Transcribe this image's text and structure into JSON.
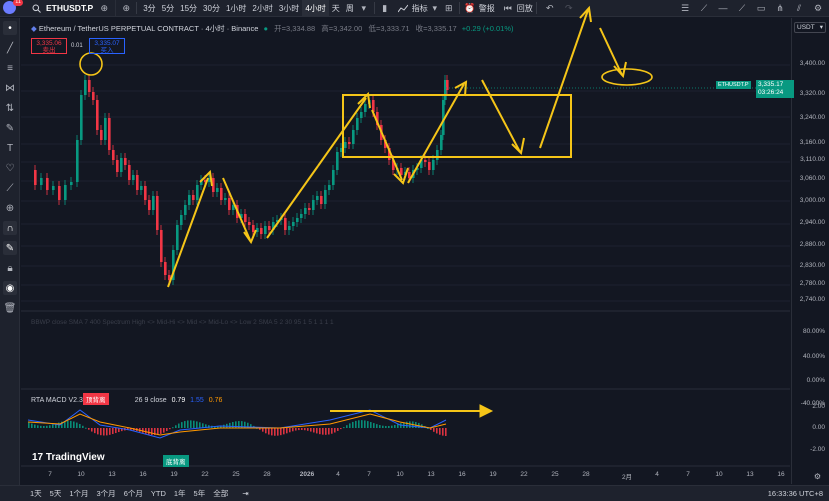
{
  "toolbar": {
    "badge": "11",
    "symbol": "ETHUSDT.P",
    "intervals": [
      "3分",
      "5分",
      "15分",
      "30分",
      "1小时",
      "2小时",
      "3小时",
      "4小时",
      "天",
      "周"
    ],
    "active_interval": "4小时",
    "indicators_label": "指标",
    "alert_label": "警报",
    "replay_label": "回放"
  },
  "legend": {
    "title": "Ethereum / TetherUS PERPETUAL CONTRACT · 4小时 · Binance",
    "open": "开=3,334.88",
    "high": "高=3,342.00",
    "low": "低=3,333.71",
    "close": "收=3,335.17",
    "change": "+0.29 (+0.01%)"
  },
  "trade": {
    "sell_price": "3,335.06",
    "sell_label": "卖出",
    "spread": "0.01",
    "buy_price": "3,335.07",
    "buy_label": "买入"
  },
  "price_scale": {
    "currency": "USDT",
    "ticks": [
      "3,400.00",
      "3,320.00",
      "3,240.00",
      "3,160.00",
      "3,110.00",
      "3,060.00",
      "3,000.00",
      "2,940.00",
      "2,880.00",
      "2,830.00",
      "2,780.00",
      "2,740.00"
    ],
    "last_symbol": "ETHUSDT.P",
    "last_price": "3,335.17",
    "countdown": "03:26:24",
    "pct_ticks": [
      "80.00%",
      "40.00%",
      "0.00%",
      "-40.00%"
    ],
    "macd_ticks": [
      "2.00",
      "0.00",
      "-2.00"
    ]
  },
  "indicator1": {
    "label": "BBWP close SMA 7 400 Spectrum High <> Mid-Hi <> Mid <> Mid-Lo <> Low 2 SMA 5 2 30 95 1 5 1 1 1 1"
  },
  "macd": {
    "name": "RTA MACD V2.31",
    "params": "26 9 close",
    "v1": "0.79",
    "v2": "1.55",
    "v3": "0.76",
    "red_badge": "顶背离",
    "green_badge": "底背离"
  },
  "logo": "TradingView",
  "time_axis": [
    "7",
    "10",
    "13",
    "16",
    "19",
    "22",
    "25",
    "28",
    "2026",
    "4",
    "7",
    "10",
    "13",
    "16",
    "19",
    "22",
    "25",
    "28",
    "2月",
    "4",
    "7",
    "10",
    "13",
    "16"
  ],
  "ranges": [
    "1天",
    "5天",
    "1个月",
    "3个月",
    "6个月",
    "YTD",
    "1年",
    "5年",
    "全部"
  ],
  "clock": "16:33:36 UTC+8",
  "colors": {
    "up": "#089981",
    "down": "#f23645",
    "annotation": "#f5c518",
    "background": "#131722"
  }
}
